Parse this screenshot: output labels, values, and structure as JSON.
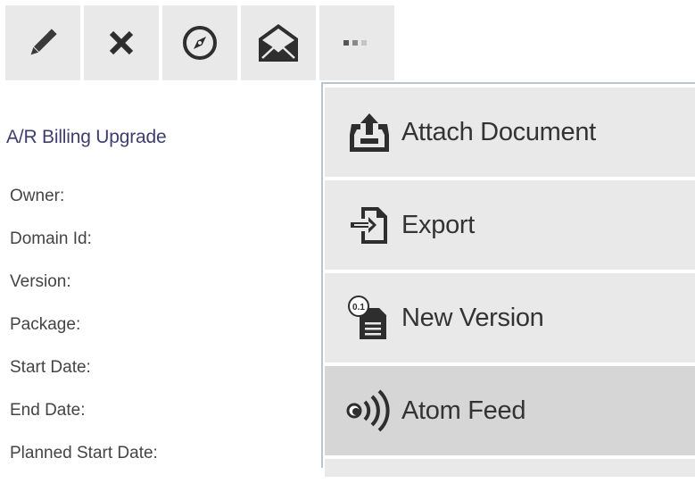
{
  "toolbar": {
    "buttons": [
      {
        "icon": "pencil-icon"
      },
      {
        "icon": "close-icon"
      },
      {
        "icon": "compass-icon"
      },
      {
        "icon": "envelope-icon"
      },
      {
        "icon": "more-dots-icon"
      }
    ]
  },
  "record": {
    "title": "A/R Billing Upgrade",
    "fields": [
      {
        "label": "Owner:"
      },
      {
        "label": "Domain Id:"
      },
      {
        "label": "Version:"
      },
      {
        "label": "Package:"
      },
      {
        "label": "Start Date:"
      },
      {
        "label": "End Date:"
      },
      {
        "label": "Planned Start Date:"
      }
    ]
  },
  "menu": {
    "items": [
      {
        "label": "Attach Document",
        "icon": "upload-tray-icon"
      },
      {
        "label": "Export",
        "icon": "export-icon"
      },
      {
        "label": "New Version",
        "icon": "new-version-icon"
      },
      {
        "label": "Atom Feed",
        "icon": "feed-icon",
        "active": true
      }
    ]
  },
  "colors": {
    "button_bg": "#e9e9e9",
    "menu_item_bg": "#e9e9e9",
    "menu_item_active_bg": "#d6d6d6",
    "title_color": "#3e3e6e",
    "menu_border": "#b9c4cf"
  }
}
